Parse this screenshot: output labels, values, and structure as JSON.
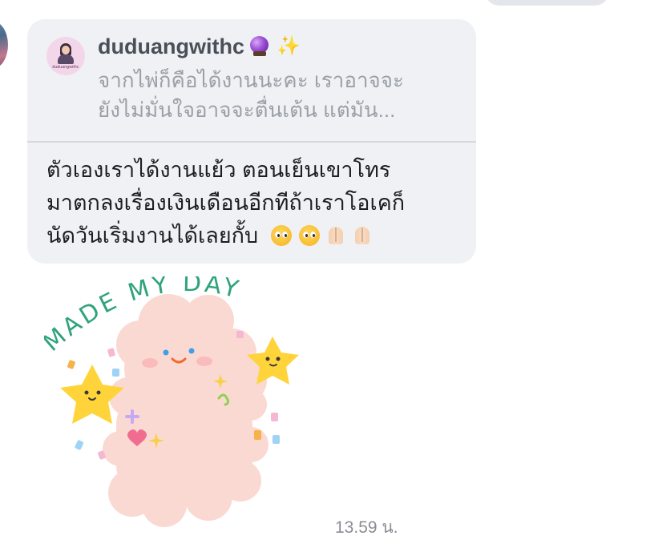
{
  "previous_message": {},
  "reply": {
    "username": "duduangwithc",
    "avatar_label": "duduangwithc",
    "name_emojis": [
      "crystal-ball",
      "sparkles"
    ],
    "preview_lines": [
      "จากไพ่ก็คือได้งานนะคะ เราอาจจะ",
      "ยังไม่มั่นใจอาจจะตื่นเต้น  แต่มัน..."
    ]
  },
  "message": {
    "lines": [
      "ตัวเองเราได้งานแย้ว ตอนเย็นเขาโทร",
      "มาตกลงเรื่องเงินเดือนอีกทีถ้าเราโอเคก็",
      "นัดวันเริ่มงานได้เลยกั้บ"
    ],
    "trailing_emojis": [
      "pleading-face",
      "pleading-face",
      "folded-hands",
      "folded-hands"
    ]
  },
  "sticker": {
    "text": "MADE MY DAY",
    "colors": {
      "lettering": "#2fa37a",
      "bear": "#fbd9d3",
      "star": "#ffd43b"
    }
  },
  "timestamp": "13.59 น.",
  "colors": {
    "bubble_bg": "#f0f1f4",
    "name": "#4a4f58",
    "preview": "#9ba0a8",
    "text": "#1c1e21",
    "timestamp": "#8a8d93"
  }
}
